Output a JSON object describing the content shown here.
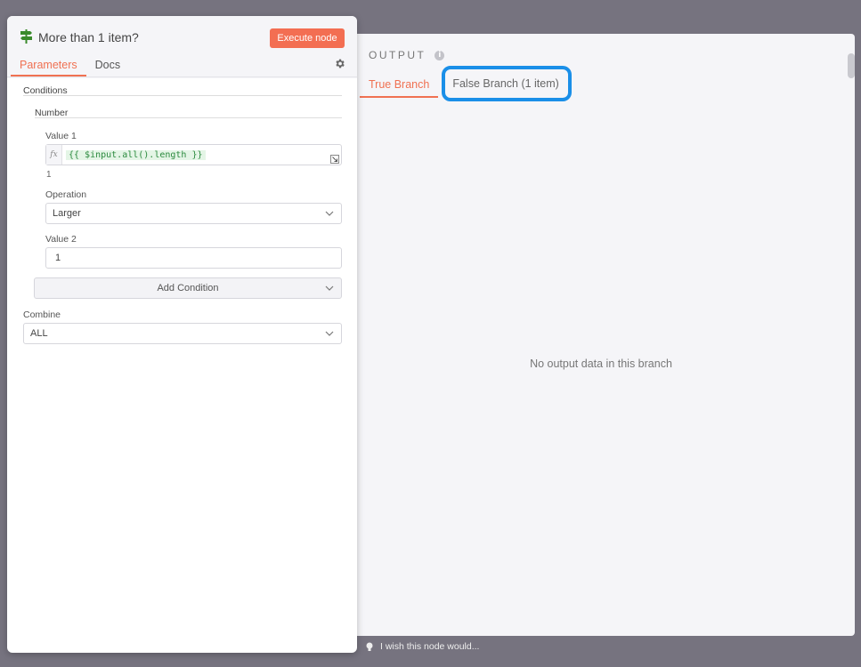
{
  "node": {
    "title": "More than 1 item?",
    "execute_label": "Execute node",
    "tabs": [
      {
        "label": "Parameters",
        "active": true
      },
      {
        "label": "Docs",
        "active": false
      }
    ]
  },
  "params": {
    "conditions_label": "Conditions",
    "number_label": "Number",
    "value1_label": "Value 1",
    "value1_expression": "{{ $input.all().length }}",
    "value1_preview": "1",
    "operation_label": "Operation",
    "operation_value": "Larger",
    "value2_label": "Value 2",
    "value2_value": "1",
    "add_condition_label": "Add Condition",
    "combine_label": "Combine",
    "combine_value": "ALL"
  },
  "output": {
    "header": "OUTPUT",
    "tabs": [
      {
        "label": "True Branch",
        "active": true
      },
      {
        "label": "False Branch (1 item)",
        "active": false
      }
    ],
    "empty_message": "No output data in this branch"
  },
  "footer": {
    "feedback_label": "I wish this node would..."
  },
  "colors": {
    "accent": "#f07152",
    "highlight": "#1a8fe8",
    "backdrop": "#76737f"
  }
}
